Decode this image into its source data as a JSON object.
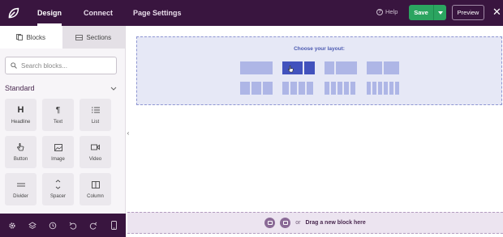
{
  "topbar": {
    "logo_icon": "seedprod-leaf-icon",
    "nav": [
      "Design",
      "Connect",
      "Page Settings"
    ],
    "help_label": "Help",
    "save_label": "Save",
    "preview_label": "Preview",
    "close_icon": "close-icon"
  },
  "sidebar": {
    "tabs": [
      "Blocks",
      "Sections"
    ],
    "search_placeholder": "Search blocks...",
    "section_title": "Standard",
    "blocks": [
      {
        "label": "Headline",
        "icon": "headline-icon"
      },
      {
        "label": "Text",
        "icon": "paragraph-icon"
      },
      {
        "label": "List",
        "icon": "list-icon"
      },
      {
        "label": "Button",
        "icon": "pointer-icon"
      },
      {
        "label": "Image",
        "icon": "image-icon"
      },
      {
        "label": "Video",
        "icon": "video-icon"
      },
      {
        "label": "Divider",
        "icon": "divider-icon"
      },
      {
        "label": "Spacer",
        "icon": "spacer-icon"
      },
      {
        "label": "Column",
        "icon": "column-icon"
      }
    ]
  },
  "bottom_toolbar": [
    "settings-icon",
    "layers-icon",
    "history-icon",
    "undo-icon",
    "redo-icon",
    "mobile-preview-icon"
  ],
  "canvas": {
    "layout_title": "Choose your layout:",
    "layouts": [
      {
        "columns": 1
      },
      {
        "columns": 2,
        "selected": true
      },
      {
        "columns": 3
      },
      {
        "columns": 4
      },
      {
        "columns": 3
      },
      {
        "columns": 4
      },
      {
        "columns": 5
      },
      {
        "columns": 6
      }
    ],
    "dropzone_or": "or",
    "dropzone_text": "Drag a new block here"
  },
  "colors": {
    "topbar_bg": "#39153f",
    "save_green": "#2ba460",
    "layout_accent": "#4252bd",
    "layout_light": "#aeb6e6"
  }
}
